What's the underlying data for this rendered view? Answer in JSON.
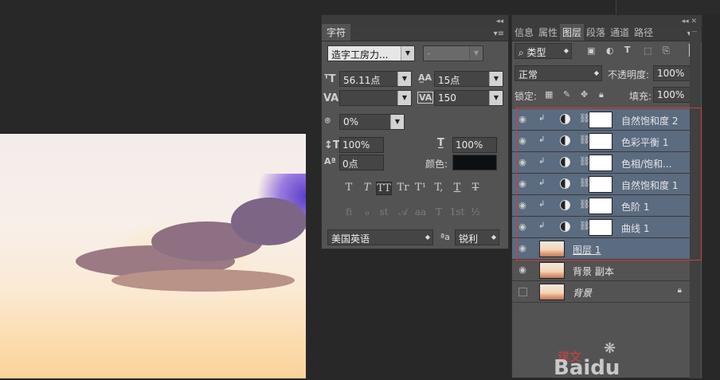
{
  "character_panel": {
    "tab": "字符",
    "font_family": "造字工房力...",
    "font_style": "-",
    "font_size": "56.11点",
    "leading": "15点",
    "kerning": "",
    "tracking": "150",
    "scale_proportional": "0%",
    "vertical_scale": "100%",
    "horizontal_scale": "100%",
    "baseline_shift": "0点",
    "color_label": "颜色:",
    "style_buttons": [
      "T",
      "T",
      "TT",
      "Tr",
      "T¹",
      "T,",
      "T",
      "T"
    ],
    "opentype_buttons": [
      "fi",
      "ℴ",
      "st",
      "𝒜",
      "aa",
      "T",
      "1st",
      "½"
    ],
    "language": "美国英语",
    "aa_label": "ªa",
    "antialias": "锐利"
  },
  "layers_panel": {
    "tabs": [
      "信息",
      "属性",
      "图层",
      "段落",
      "通道",
      "路径"
    ],
    "active_tab": "图层",
    "filter_kind": "类型",
    "blend_mode": "正常",
    "opacity_label": "不透明度:",
    "opacity": "100%",
    "lock_label": "锁定:",
    "fill_label": "填充:",
    "fill": "100%",
    "layers": [
      {
        "name": "自然饱和度 2",
        "type": "adjustment",
        "selected": true,
        "visible": true
      },
      {
        "name": "色彩平衡 1",
        "type": "adjustment",
        "selected": true,
        "visible": true
      },
      {
        "name": "色相/饱和...",
        "type": "adjustment",
        "selected": true,
        "visible": true
      },
      {
        "name": "自然饱和度 1",
        "type": "adjustment",
        "selected": true,
        "visible": true
      },
      {
        "name": "色阶 1",
        "type": "adjustment",
        "selected": true,
        "visible": true
      },
      {
        "name": "曲线 1",
        "type": "adjustment",
        "selected": true,
        "visible": true
      },
      {
        "name": "图层 1",
        "type": "image",
        "selected": true,
        "visible": true
      },
      {
        "name": "背景 副本",
        "type": "image",
        "selected": false,
        "visible": true
      },
      {
        "name": "背景",
        "type": "image",
        "selected": false,
        "visible": false,
        "locked": true
      }
    ]
  },
  "watermark": {
    "text": "Baidu",
    "cn": "建文"
  }
}
